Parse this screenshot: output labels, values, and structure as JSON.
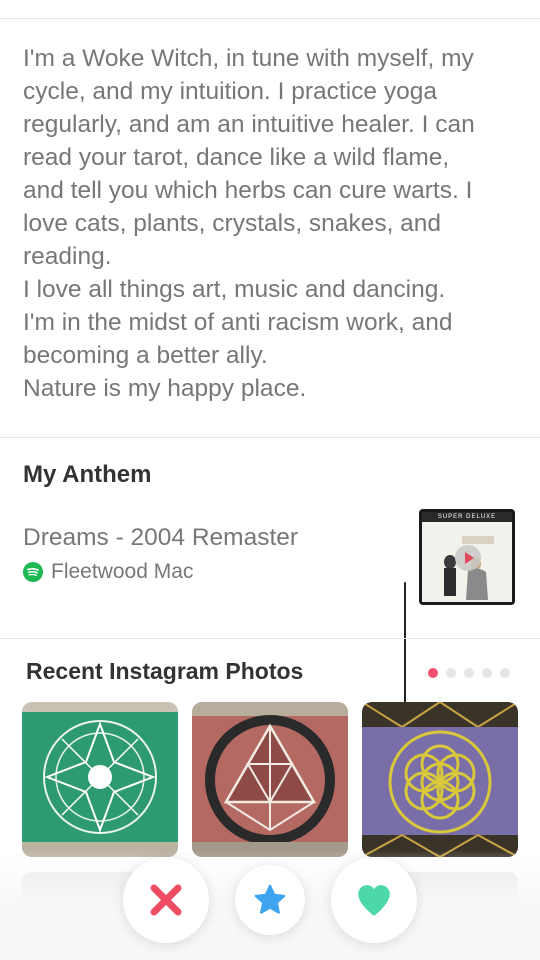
{
  "bio": {
    "lines": [
      "I'm a Woke Witch, in tune with myself, my",
      "cycle, and my intuition. I practice yoga",
      "regularly, and am an intuitive healer. I can",
      "read your tarot, dance like a wild flame,",
      "and tell you which herbs can cure warts. I",
      "love cats, plants, crystals, snakes, and",
      "reading.",
      "I love all things art, music and dancing.",
      "I'm in the midst of anti racism work, and",
      "becoming a better ally.",
      "Nature is my happy place."
    ]
  },
  "anthem": {
    "heading": "My Anthem",
    "song": "Dreams - 2004 Remaster",
    "artist": "Fleetwood Mac",
    "album_banner": "SUPER DELUXE",
    "spotify_icon": "spotify-icon"
  },
  "instagram": {
    "heading": "Recent Instagram Photos",
    "page_count": 5,
    "active_page": 1
  },
  "actions": {
    "nope_icon": "x-icon",
    "super_like_icon": "star-icon",
    "like_icon": "heart-icon"
  },
  "colors": {
    "accent_red": "#f0506e",
    "spotify_green": "#1db954",
    "super_like_blue": "#3ea4f0",
    "like_green": "#4cd9a7"
  }
}
